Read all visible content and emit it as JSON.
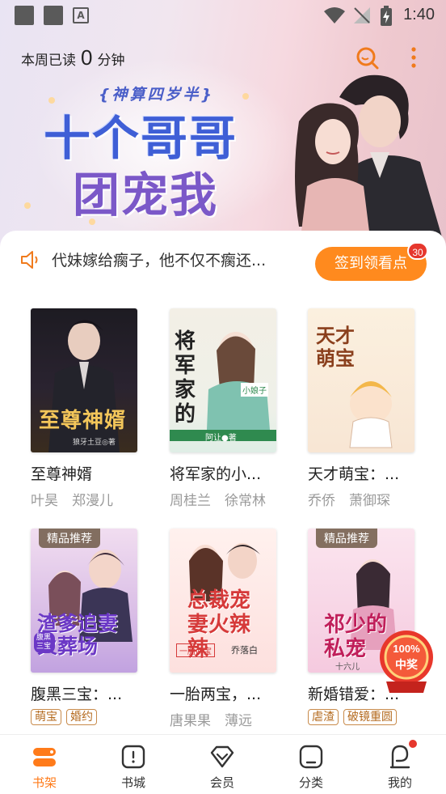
{
  "status_bar": {
    "time": "1:40"
  },
  "header": {
    "reading_prefix": "本周已读",
    "reading_minutes": "0",
    "reading_suffix": "分钟"
  },
  "banner": {
    "subtitle": "{神算四岁半}",
    "title_line1": "十个哥哥",
    "title_line2": "团宠我"
  },
  "notice": {
    "text": "代妹嫁给瘸子，他不仅不瘸还...",
    "checkin_label": "签到领看点",
    "checkin_badge": "30"
  },
  "books": [
    {
      "title": "至尊神婿",
      "authors": "叶昊　郑漫儿",
      "cover_text": "至尊神婿",
      "cover_credit": "狼牙土豆◎著"
    },
    {
      "title": "将军家的小...",
      "authors": "周桂兰　徐常林",
      "cover_text": "将军家的",
      "cover_credit": "阿让●著",
      "cover_small": "小娘子"
    },
    {
      "title": "天才萌宝：...",
      "authors": "乔侨　萧御琛",
      "cover_text": "天才萌宝"
    },
    {
      "title": "腹黑三宝：...",
      "badge": "精品推荐",
      "tags": [
        "萌宝",
        "婚约"
      ],
      "cover_text": "渣爹追妻火葬场",
      "cover_small": "腹黑三宝"
    },
    {
      "title": "一胎两宝，...",
      "authors": "唐果果　薄远",
      "cover_text": "总裁宠妻火辣辣",
      "cover_credit": "乔落白",
      "cover_small": "一胎两宝"
    },
    {
      "title": "新婚错爱：...",
      "badge": "精品推荐",
      "tags": [
        "虐渣",
        "破镜重圆"
      ],
      "cover_text": "祁少的私宠",
      "cover_credit": "十六儿"
    }
  ],
  "prize": {
    "line1": "100%",
    "line2": "中奖"
  },
  "nav": [
    {
      "label": "书架",
      "active": true
    },
    {
      "label": "书城"
    },
    {
      "label": "会员"
    },
    {
      "label": "分类"
    },
    {
      "label": "我的"
    }
  ],
  "colors": {
    "accent": "#ff8a1e",
    "badge_red": "#e6372d",
    "nav_active": "#ff7b1a"
  }
}
